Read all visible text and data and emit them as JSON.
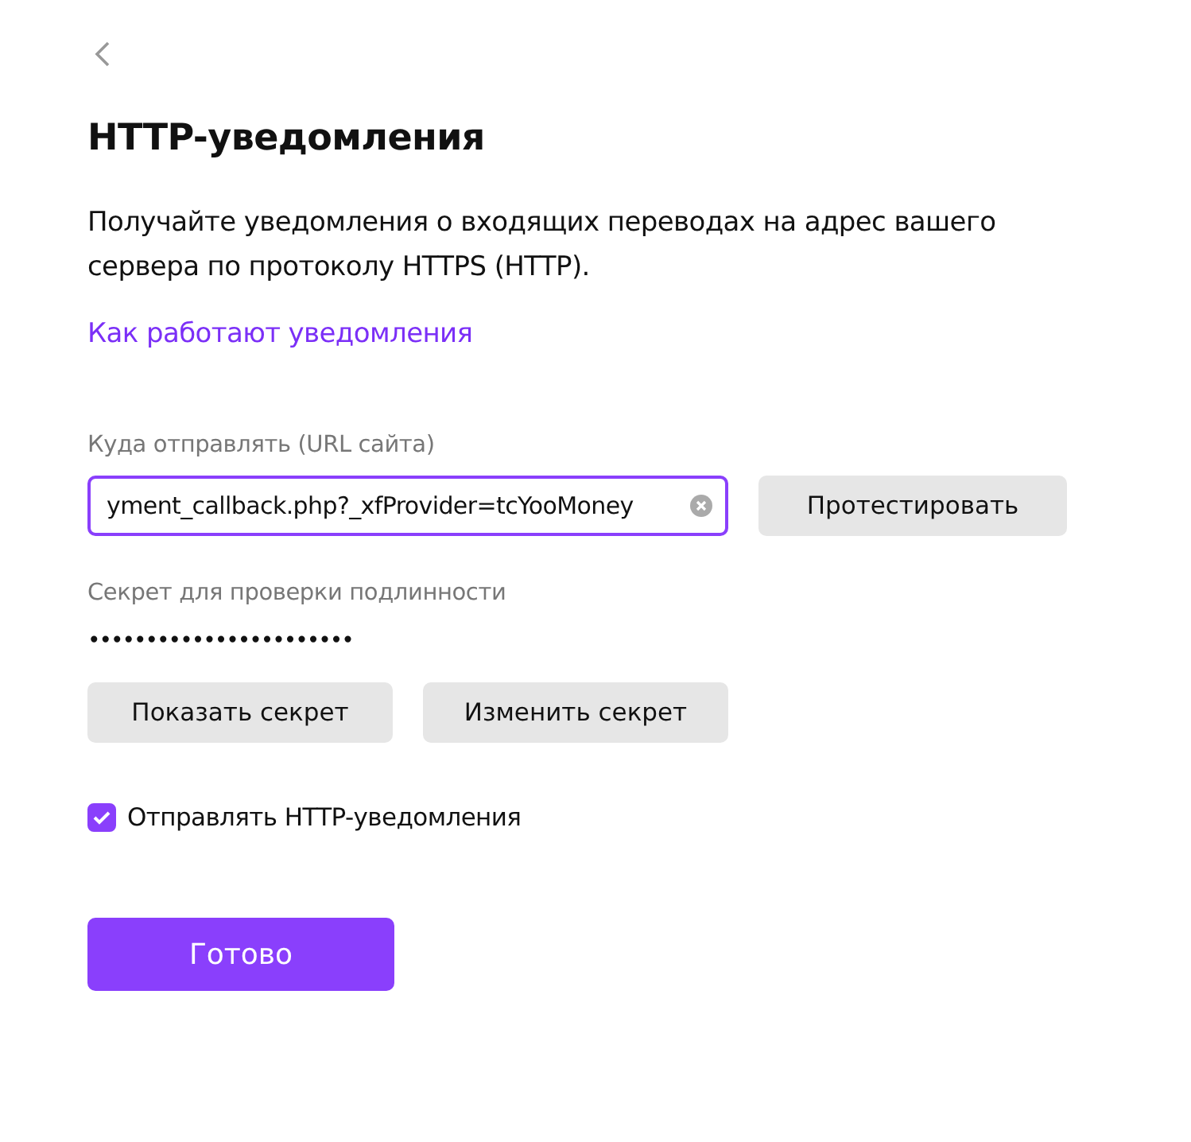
{
  "title": "HTTP-уведомления",
  "description": "Получайте уведомления о входящих переводах на адрес вашего сервера по протоколу HTTPS (HTTP).",
  "help_link": "Как работают уведомления",
  "url_field": {
    "label": "Куда отправлять (URL сайта)",
    "value": "yment_callback.php?_xfProvider=tcYooMoney",
    "focused": true
  },
  "test_button": "Протестировать",
  "secret": {
    "label": "Секрет для проверки подлинности",
    "value": "•••••••••••••••••••••••"
  },
  "secret_buttons": [
    "Показать секрет",
    "Изменить секрет"
  ],
  "send_checkbox": {
    "label": "Отправлять HTTP-уведомления",
    "checked": true
  },
  "done_button": "Готово"
}
